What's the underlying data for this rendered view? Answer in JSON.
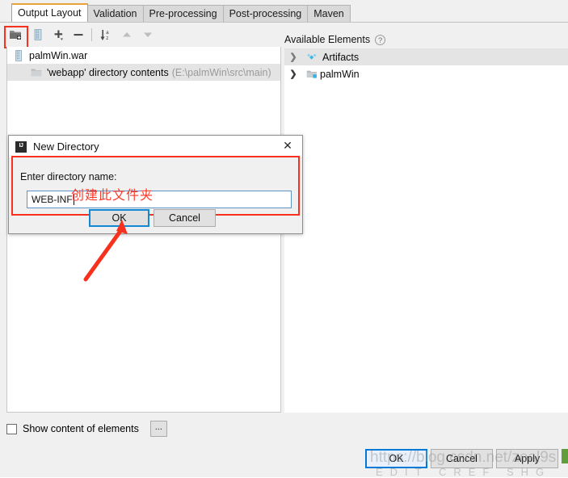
{
  "window": {
    "tabs": [
      {
        "label": "Output Layout",
        "selected": true
      },
      {
        "label": "Validation",
        "selected": false
      },
      {
        "label": "Pre-processing",
        "selected": false
      },
      {
        "label": "Post-processing",
        "selected": false
      },
      {
        "label": "Maven",
        "selected": false
      }
    ]
  },
  "toolbar": {
    "buttons": [
      {
        "name": "create-directory-icon",
        "tooltip": "Create Directory",
        "highlighted": true
      },
      {
        "name": "create-archive-icon",
        "tooltip": "Create Archive"
      },
      {
        "name": "add-icon",
        "tooltip": "Add"
      },
      {
        "name": "remove-icon",
        "tooltip": "Remove"
      },
      {
        "name": "sort-icon",
        "tooltip": "Sort"
      },
      {
        "name": "move-up-icon",
        "tooltip": "Move Up"
      },
      {
        "name": "move-down-icon",
        "tooltip": "Move Down"
      }
    ]
  },
  "output_tree": {
    "rows": [
      {
        "label": "palmWin.war",
        "detail": "",
        "icon": "archive-icon",
        "indent": 0,
        "shaded": false
      },
      {
        "label": "'webapp' directory contents",
        "detail": "(E:\\palmWin\\src\\main)",
        "icon": "folder-icon",
        "indent": 1,
        "shaded": true
      }
    ]
  },
  "available": {
    "title": "Available Elements",
    "help_icon": "?",
    "rows": [
      {
        "label": "Artifacts",
        "icon": "artifacts-icon",
        "shaded": true
      },
      {
        "label": "palmWin",
        "icon": "module-icon",
        "shaded": false
      }
    ]
  },
  "footer": {
    "show_content_label": "Show content of elements",
    "show_content_checked": false,
    "ellipsis_label": "...",
    "buttons": [
      {
        "label": "OK",
        "focused": true
      },
      {
        "label": "Cancel",
        "focused": false
      },
      {
        "label": "Apply",
        "focused": false
      }
    ]
  },
  "dialog": {
    "title": "New Directory",
    "app_icon": "intellij-icon",
    "close_icon": "✕",
    "field_label": "Enter directory name:",
    "field_value": "WEB-INF",
    "ok_label": "OK",
    "cancel_label": "Cancel"
  },
  "annotations": {
    "chinese_note": "创建此文件夹",
    "note_color": "#fd3a2a",
    "highlight_color": "#f8311e"
  },
  "watermark": {
    "line1": "https://blog.csdn.net/zeal9s",
    "line2": "EDIT  CREF    SHG"
  }
}
